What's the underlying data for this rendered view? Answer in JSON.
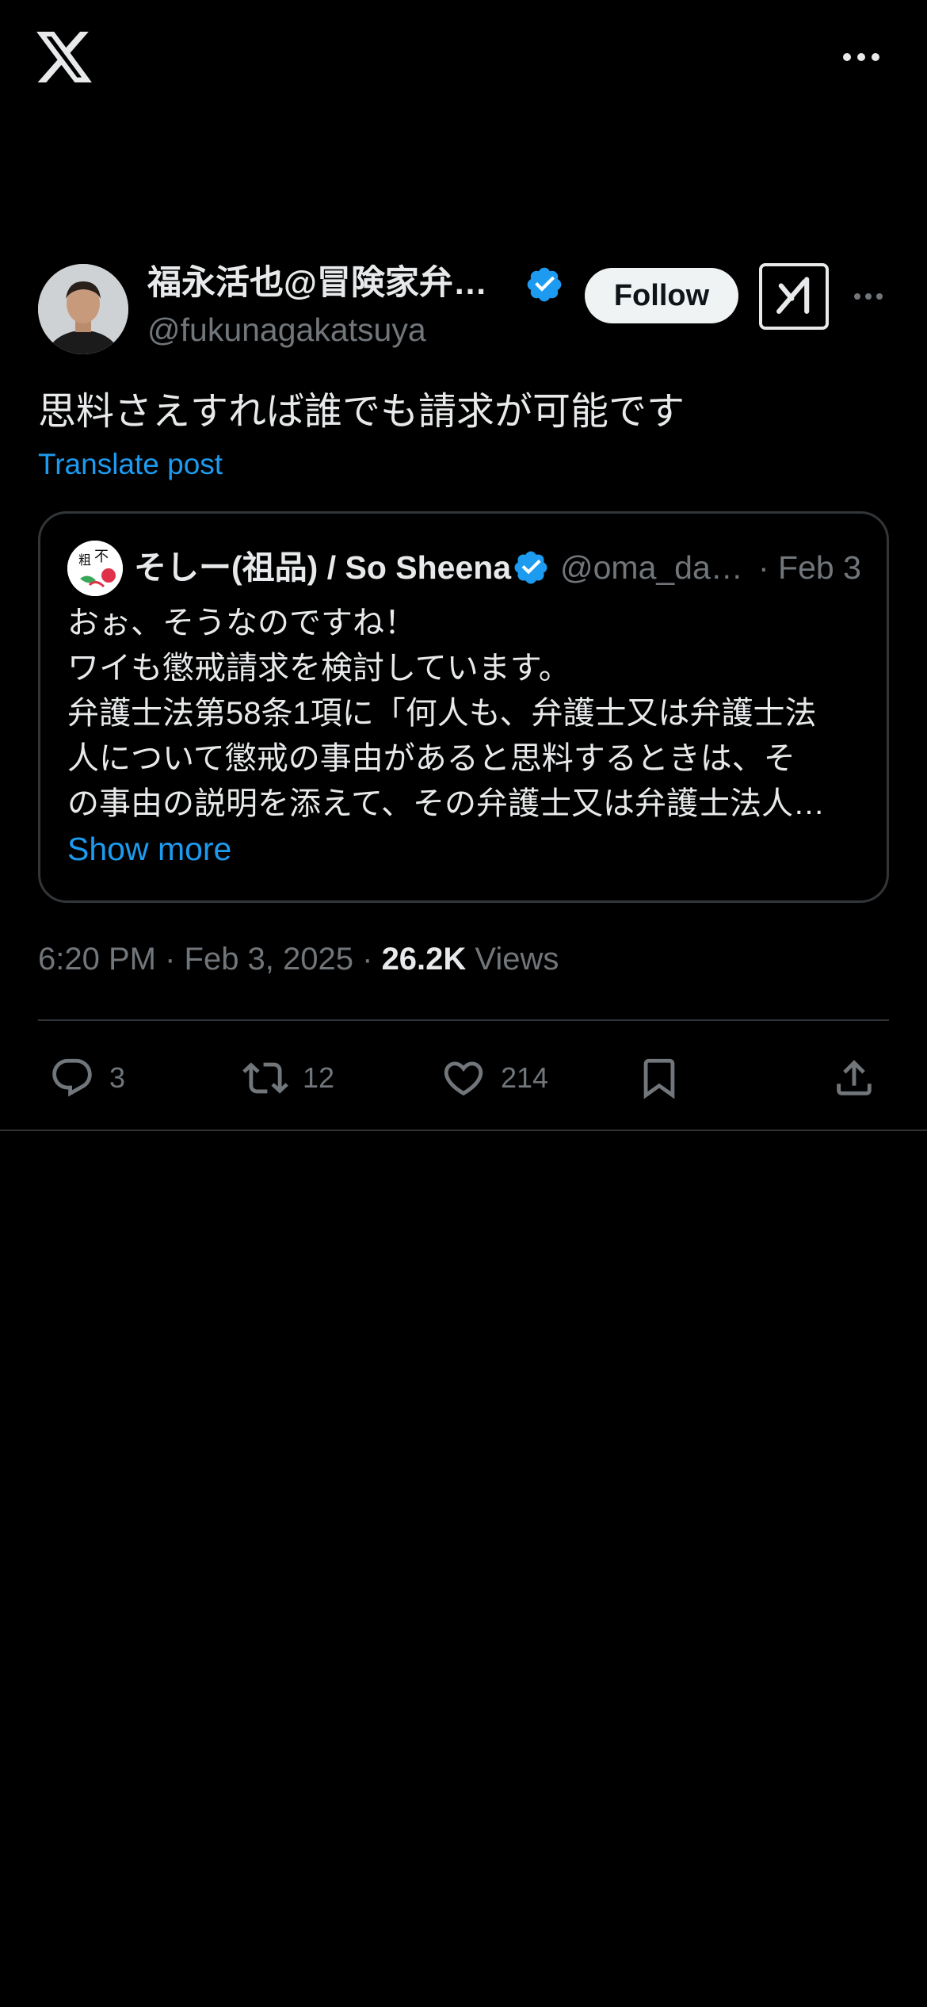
{
  "header": {
    "logo_icon": "x-logo-icon",
    "more_icon": "more-horizontal-icon"
  },
  "tweet": {
    "author": {
      "name": "福永活也@冒険家弁護士",
      "handle": "@fukunagakatsuya",
      "verified": true
    },
    "follow_label": "Follow",
    "grok_icon": "grok-icon",
    "text": "思料さえすれば誰でも請求が可能です",
    "translate_label": "Translate post",
    "quote": {
      "author_name": "そしー(祖品) / So Sheena",
      "handle": "@oma_darling",
      "date": "· Feb 3",
      "lines": [
        "おぉ、そうなのですね！",
        "ワイも懲戒請求を検討しています。",
        "弁護士法第58条1項に「何人も、弁護士又は弁護士法",
        "人について懲戒の事由があると思料するときは、そ",
        "の事由の説明を添えて、その弁護士又は弁護士法人…"
      ],
      "show_more_label": "Show more"
    },
    "timestamp": "6:20 PM · Feb 3, 2025 · ",
    "views_count": "26.2K",
    "views_label": " Views",
    "actions": {
      "replies": "3",
      "reposts": "12",
      "likes": "214"
    }
  },
  "colors": {
    "background": "#000000",
    "accent": "#1d9bf0",
    "text_primary": "#e7e9ea",
    "text_secondary": "#71767b",
    "divider": "#2f3336"
  }
}
